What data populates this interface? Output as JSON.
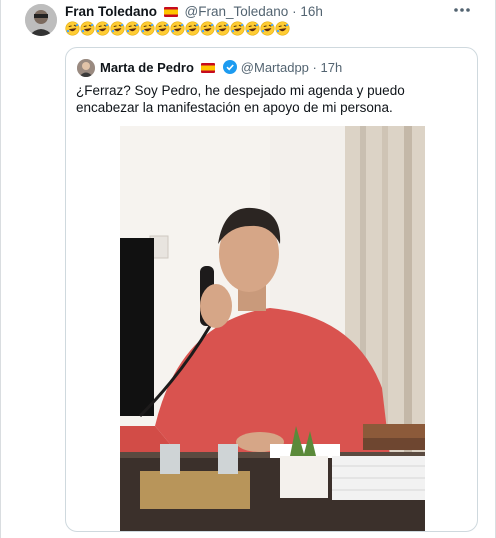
{
  "tweet": {
    "author_name": "Fran Toledano",
    "author_handle": "@Fran_Toledano",
    "time": "16h",
    "separator": "·",
    "emoji_count": 15,
    "emoji_name": "rolling-on-the-floor-laughing"
  },
  "quoted": {
    "author_name": "Marta de Pedro",
    "author_handle": "@Martadpp",
    "time": "17h",
    "separator": "·",
    "text": "¿Ferraz? Soy Pedro, he despejado mi agenda y puedo encabezar la manifestación en apoyo de mi persona."
  },
  "colors": {
    "text": "#0f1419",
    "muted": "#536471",
    "border": "#cfd9de",
    "verified": "#1d9bf0",
    "flag_red": "#c60b1e",
    "flag_yellow": "#ffc400"
  },
  "icons": [
    "more-icon",
    "verified-icon",
    "spain-flag-icon",
    "rolling-laughing-emoji"
  ]
}
